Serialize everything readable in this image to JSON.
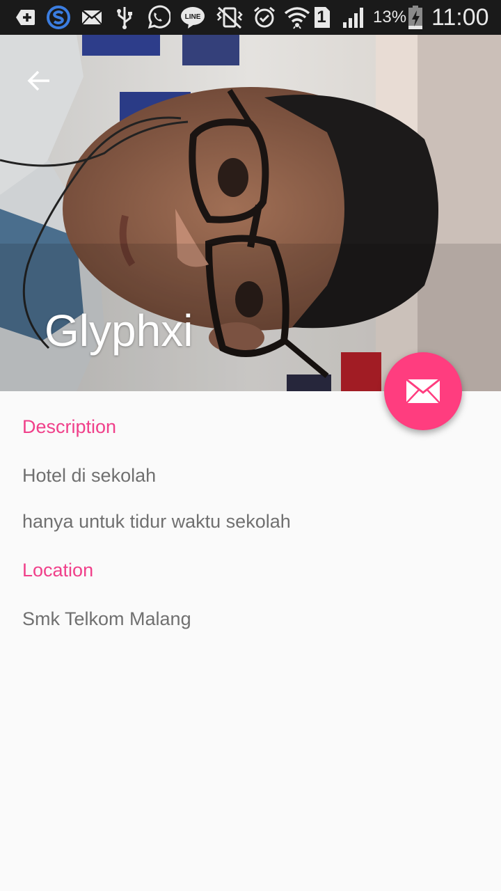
{
  "status_bar": {
    "battery_percent": "13%",
    "time": "11:00",
    "sim_slot": "1",
    "icons": [
      "add-box-icon",
      "s-app-icon",
      "mail-icon",
      "usb-icon",
      "whatsapp-icon",
      "line-app-icon",
      "vibrate-mute-icon",
      "alarm-icon",
      "wifi-icon",
      "sim-1-icon",
      "signal-icon",
      "battery-charging-icon"
    ]
  },
  "header": {
    "title": "Glyphxi",
    "back_icon": "arrow-back-icon"
  },
  "fab": {
    "icon": "mail-icon",
    "color": "#ff3d7f"
  },
  "details": {
    "description_label": "Description",
    "description_line1": "Hotel di sekolah",
    "description_line2": "hanya untuk tidur waktu sekolah",
    "location_label": "Location",
    "location_value": "Smk Telkom Malang"
  },
  "colors": {
    "accent": "#f0408a",
    "body_text": "#707070",
    "status_bar_bg": "#1a1a1a"
  }
}
